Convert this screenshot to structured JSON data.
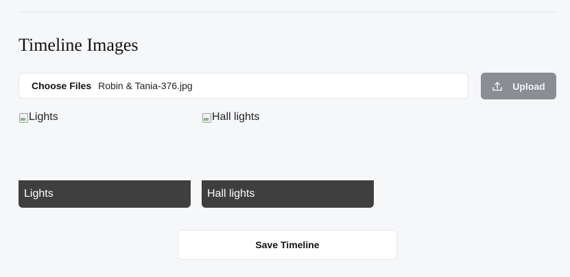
{
  "section": {
    "title": "Timeline Images"
  },
  "file_input": {
    "choose_label": "Choose Files",
    "file_name": "Robin & Tania-376.jpg"
  },
  "upload": {
    "label": "Upload",
    "icon": "upload-icon"
  },
  "images": [
    {
      "alt": "Lights",
      "caption": "Lights"
    },
    {
      "alt": "Hall lights",
      "caption": "Hall lights"
    }
  ],
  "save": {
    "label": "Save Timeline"
  },
  "colors": {
    "background": "#f6f7f9",
    "upload_button": "#8a8d94",
    "caption_bar": "#3f3f3f"
  }
}
